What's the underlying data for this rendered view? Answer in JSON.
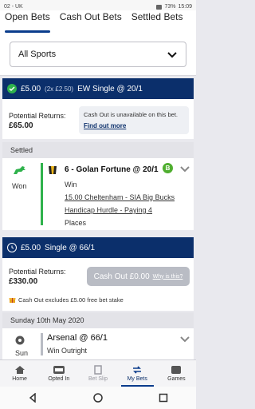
{
  "status_bar": {
    "left": "02 - UK",
    "battery": "73%",
    "time": "15:09"
  },
  "tabs": [
    "Open Bets",
    "Cash Out Bets",
    "Settled Bets"
  ],
  "filter": {
    "selected": "All Sports"
  },
  "bet1": {
    "stake": "£5.00",
    "stake_detail": "(2x £2.50)",
    "bet_type": "EW Single @ 20/1",
    "returns_label": "Potential Returns:",
    "returns_value": "£65.00",
    "cashout_note": "Cash Out is unavailable on this bet.",
    "find_out_more": "Find out more"
  },
  "section_settled": "Settled",
  "selection1": {
    "result": "Won",
    "title": "6 - Golan Fortune @ 20/1",
    "market": "Win",
    "event_line1": "15.00 Cheltenham - SIA Big Bucks",
    "event_line2": "Handicap Hurdle - Paying 4",
    "event_line3": "Places",
    "badge": "B"
  },
  "bet2": {
    "stake": "£5.00",
    "bet_type": "Single @ 66/1",
    "returns_label": "Potential Returns:",
    "returns_value": "£330.00",
    "cashout_label": "Cash Out £0.00",
    "why_label": "Why is this?",
    "free_bet_note": "Cash Out excludes £5.00 free bet stake"
  },
  "section_date": "Sunday 10th May 2020",
  "selection2": {
    "day": "Sun",
    "title": "Arsenal @ 66/1",
    "market": "Win Outright"
  },
  "bottom_nav": [
    {
      "label": "Home",
      "icon": "home-icon"
    },
    {
      "label": "Opted In",
      "icon": "opted-in-icon"
    },
    {
      "label": "Bet Slip",
      "icon": "bet-slip-icon"
    },
    {
      "label": "My Bets",
      "icon": "my-bets-icon"
    },
    {
      "label": "Games",
      "icon": "games-icon"
    }
  ],
  "colors": {
    "brand_blue": "#0b2f6b",
    "win_green": "#2fb24c",
    "accent_yellow": "#e8b21a"
  }
}
